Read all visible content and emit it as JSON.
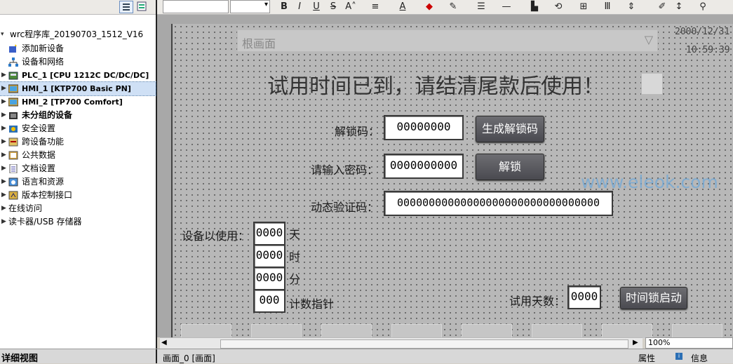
{
  "tree": {
    "root": "wrc程序库_20190703_1512_V16",
    "items": [
      {
        "label": "添加新设备",
        "icon": "add-device-icon"
      },
      {
        "label": "设备和网络",
        "icon": "network-icon"
      },
      {
        "label": "PLC_1 [CPU 1212C DC/DC/DC]",
        "icon": "plc-icon"
      },
      {
        "label": "HMI_1 [KTP700 Basic PN]",
        "icon": "hmi-icon"
      },
      {
        "label": "HMI_2 [TP700 Comfort]",
        "icon": "hmi-icon"
      },
      {
        "label": "未分组的设备",
        "icon": "folder-icon"
      },
      {
        "label": "安全设置",
        "icon": "security-icon"
      },
      {
        "label": "跨设备功能",
        "icon": "cross-device-icon"
      },
      {
        "label": "公共数据",
        "icon": "common-data-icon"
      },
      {
        "label": "文档设置",
        "icon": "document-icon"
      },
      {
        "label": "语言和资源",
        "icon": "language-icon"
      },
      {
        "label": "版本控制接口",
        "icon": "version-control-icon"
      },
      {
        "label": "在线访问",
        "icon": "online-icon"
      },
      {
        "label": "读卡器/USB 存储器",
        "icon": "card-reader-icon"
      }
    ]
  },
  "bottom": {
    "detail_view": "详细视图",
    "screen_tab": "画面_0 [画面]",
    "properties": "属性",
    "info": "信息"
  },
  "editor": {
    "zoom": "100%",
    "font_size_value": "",
    "root_screen": "根画面",
    "date": "2000/12/31",
    "time": "10:59:39"
  },
  "hmi": {
    "title": "试用时间已到，请结清尾款后使用！",
    "unlock_code_label": "解锁码：",
    "unlock_code_value": "00000000",
    "gen_unlock_button": "生成解锁码",
    "password_label": "请输入密码：",
    "password_value": "0000000000",
    "unlock_button": "解锁",
    "dynamic_code_label": "动态验证码：",
    "dynamic_code_value": "00000000000000000000000000000000",
    "used_label": "设备以使用：",
    "days_value": "0000",
    "days_unit": "天",
    "hours_value": "0000",
    "hours_unit": "时",
    "minutes_value": "0000",
    "minutes_unit": "分",
    "counter_value": "000",
    "counter_unit": "计数指针",
    "trial_days_label": "试用天数：",
    "trial_days_value": "0000",
    "timer_lock_button": "时间锁启动"
  },
  "watermark": "www.eleok.com"
}
